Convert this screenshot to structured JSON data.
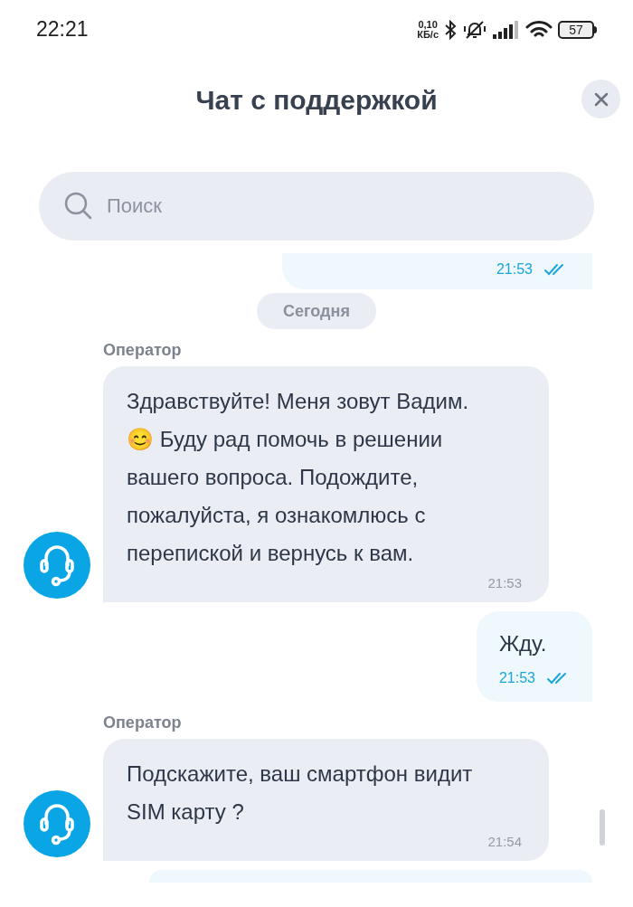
{
  "status_bar": {
    "time": "22:21",
    "speed_value": "0,10",
    "speed_unit": "КБ/с",
    "battery": "57"
  },
  "header": {
    "title": "Чат с поддержкой"
  },
  "search": {
    "placeholder": "Поиск"
  },
  "messages": [
    {
      "kind": "user_partial",
      "time": "21:53",
      "read": true
    },
    {
      "kind": "date",
      "text": "Сегодня"
    },
    {
      "kind": "operator",
      "sender": "Оператор",
      "text": "Здравствуйте! Меня зовут Вадим. 😊 Буду рад помочь в решении вашего вопроса. Подождите, пожалуйста, я ознакомлюсь с перепиской и вернусь к вам.",
      "time": "21:53"
    },
    {
      "kind": "user",
      "text": "Жду.",
      "time": "21:53",
      "read": true
    },
    {
      "kind": "operator",
      "sender": "Оператор",
      "text": "Подскажите, ваш смартфон видит SIM карту ?",
      "time": "21:54"
    },
    {
      "kind": "user_stub"
    }
  ]
}
